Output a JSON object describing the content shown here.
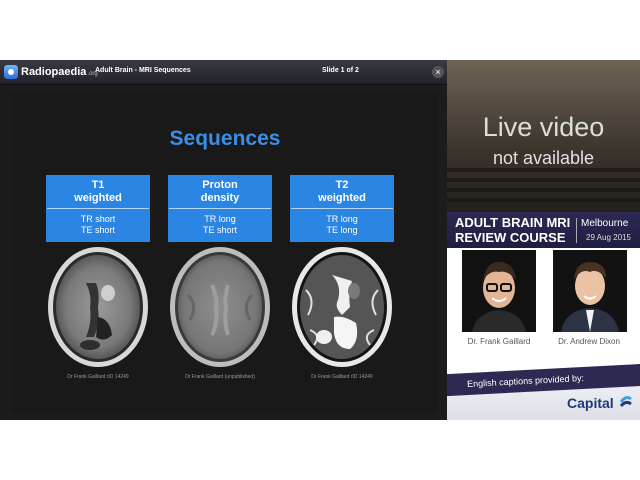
{
  "slide_header": {
    "logo_text": "Radiopaedia",
    "logo_suffix": ".org",
    "deck_title": "Adult Brain - MRI Sequences",
    "slide_counter": "Slide 1 of 2",
    "close_label": "×"
  },
  "slide": {
    "heading": "Sequences",
    "columns": [
      {
        "title_line1": "T1",
        "title_line2": "weighted",
        "tr": "TR short",
        "te": "TE short",
        "credit": "Dr Frank Gaillard rID 14249"
      },
      {
        "title_line1": "Proton",
        "title_line2": "density",
        "tr": "TR long",
        "te": "TE short",
        "credit": "Dr Frank Gaillard (unpublished)"
      },
      {
        "title_line1": "T2",
        "title_line2": "weighted",
        "tr": "TR long",
        "te": "TE long",
        "credit": "Dr Frank Gaillard rID 14249"
      }
    ]
  },
  "video": {
    "line1": "Live video",
    "line2": "not available"
  },
  "course": {
    "title_line1": "ADULT BRAIN MRI",
    "title_line2": "REVIEW COURSE",
    "city": "Melbourne",
    "date": "29 Aug 2015",
    "presenters": [
      "Dr. Frank Gaillard",
      "Dr. Andrew Dixon"
    ],
    "captions_text": "English captions provided by:",
    "sponsor": "Capital"
  },
  "colors": {
    "accent": "#2b85e3",
    "heading": "#3b8ee6",
    "banner": "#2c2a52"
  }
}
